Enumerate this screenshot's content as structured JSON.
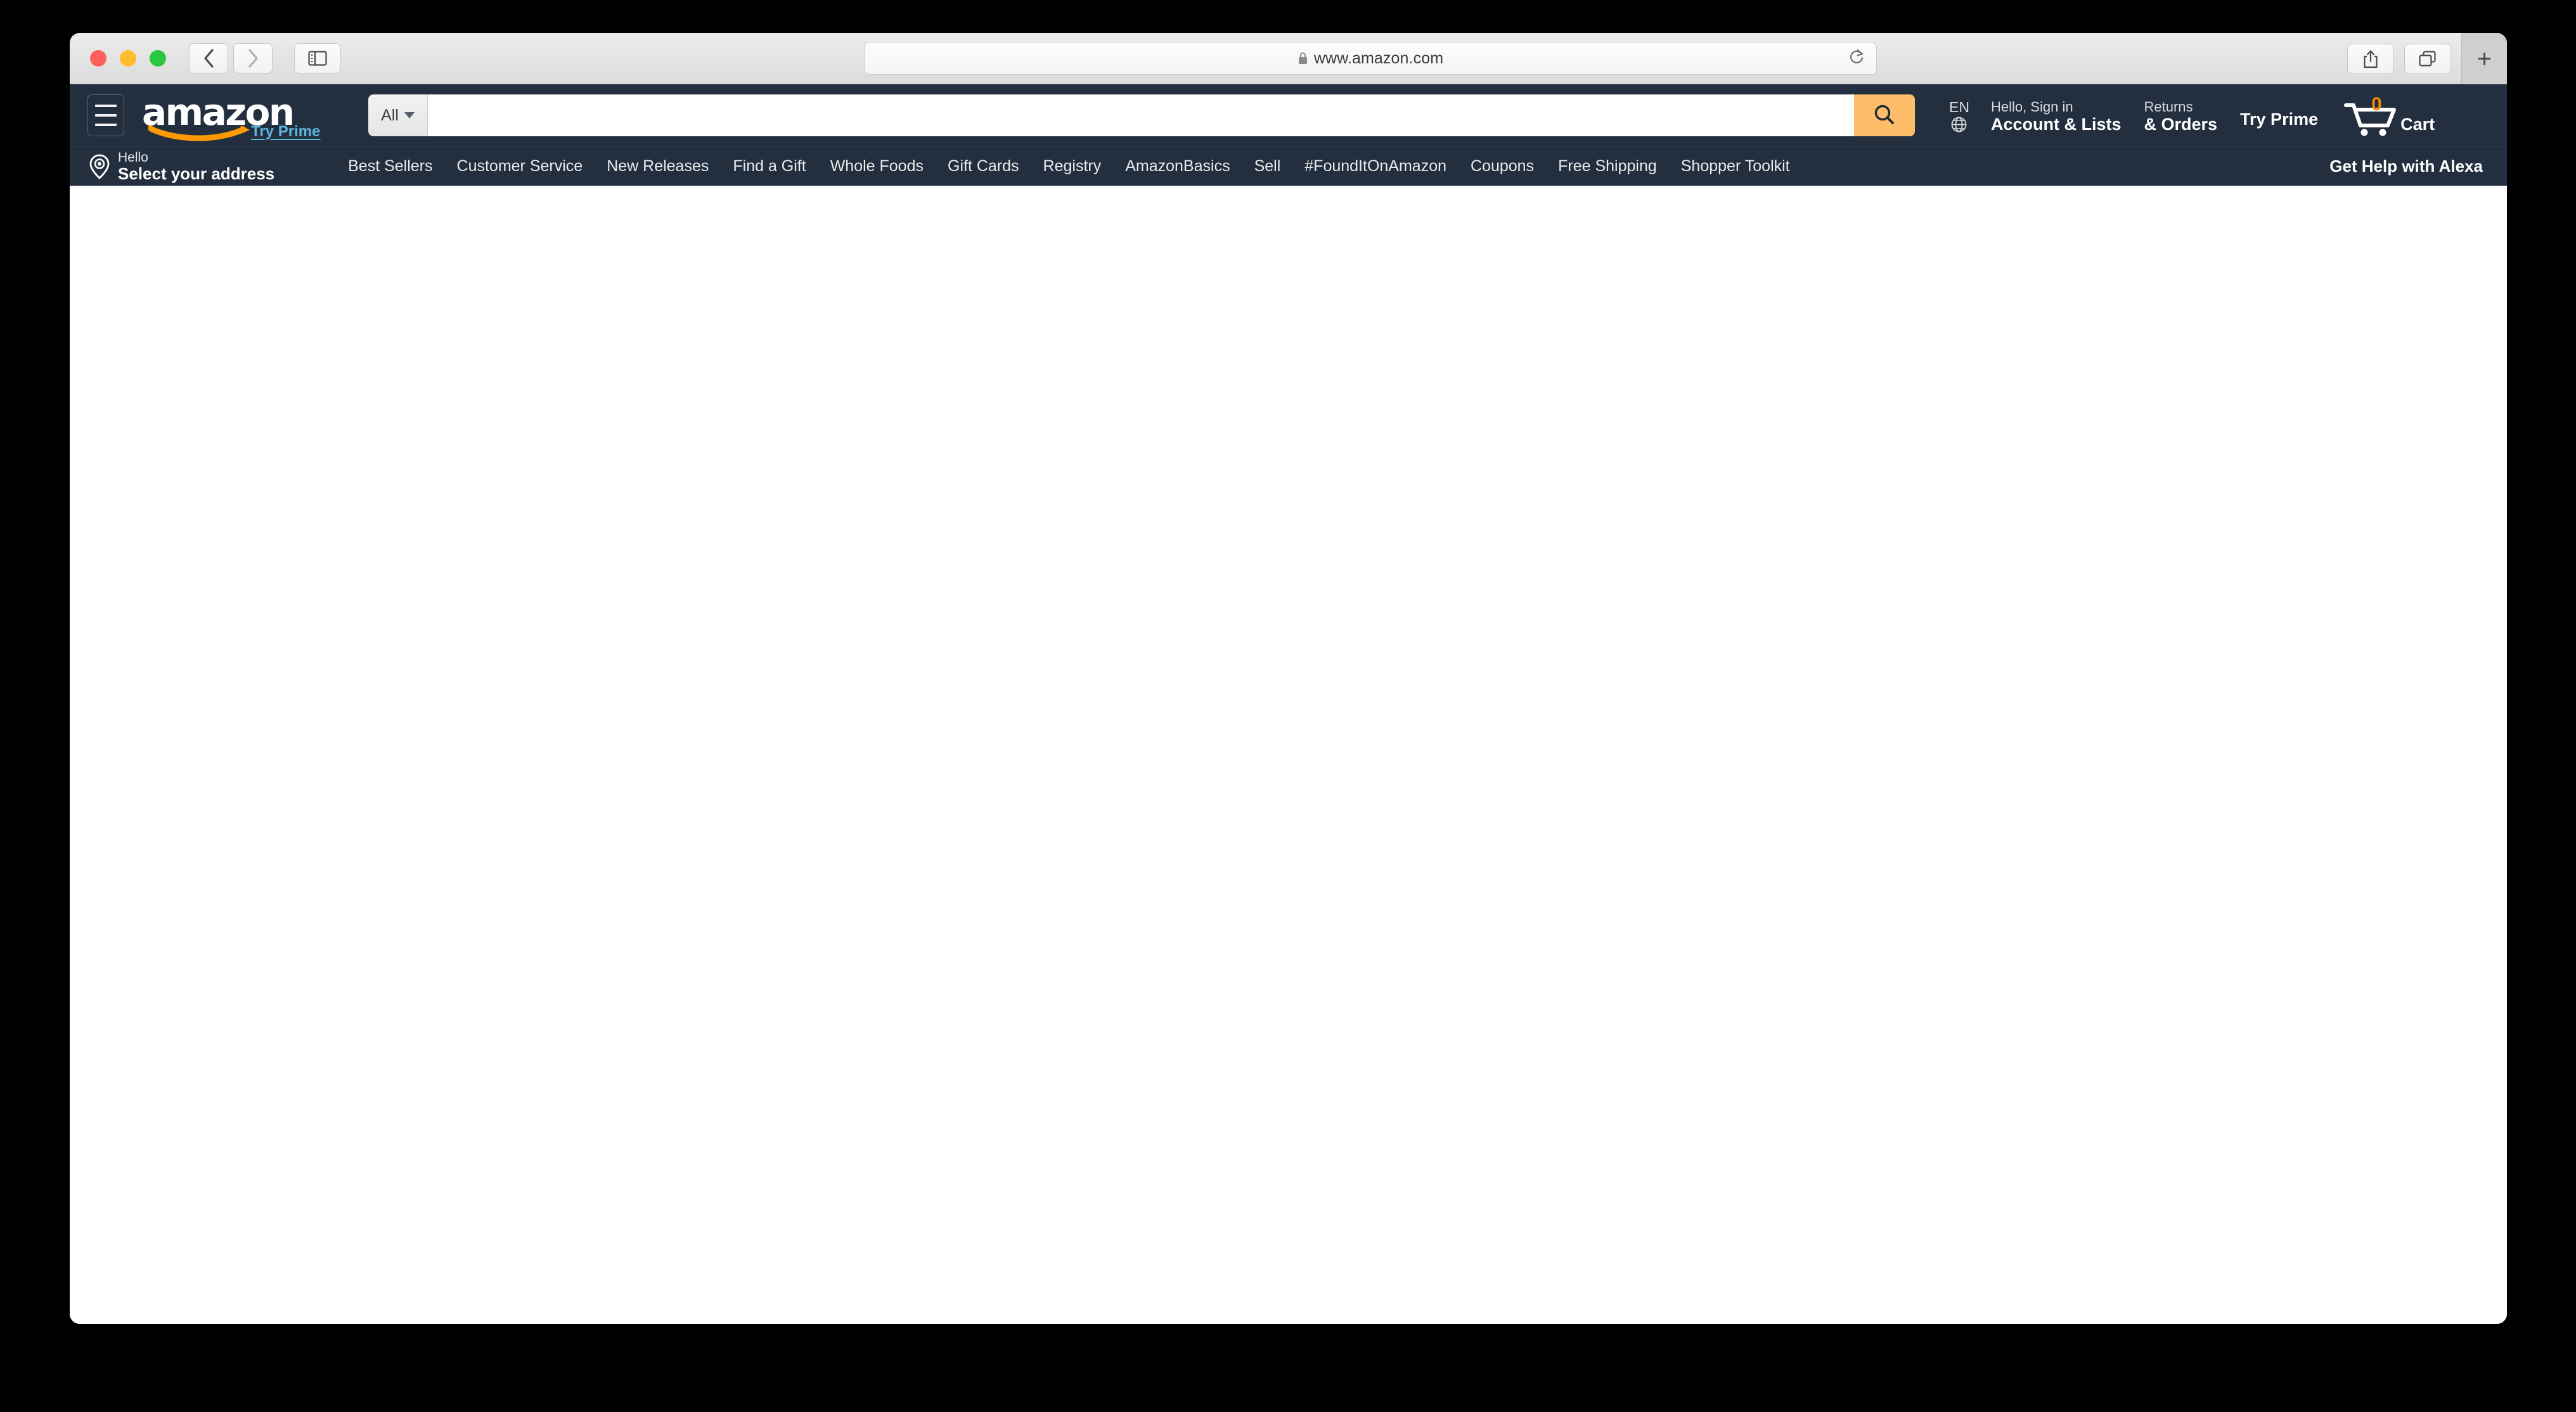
{
  "browser": {
    "url": "www.amazon.com",
    "lock_icon": "lock-icon",
    "reload_icon": "reload-icon",
    "back_icon": "chevron-left-icon",
    "forward_icon": "chevron-right-icon",
    "sidebar_icon": "sidebar-toggle-icon",
    "share_icon": "share-icon",
    "tab_overview_icon": "tab-overview-icon",
    "new_tab_label": "+"
  },
  "header": {
    "menu_icon": "hamburger-menu-icon",
    "logo_text": "amazon",
    "try_prime_link": "Try Prime",
    "search": {
      "category": "All",
      "value": "",
      "placeholder": "",
      "button_icon": "search-icon"
    },
    "language": {
      "code": "EN",
      "icon": "globe-icon"
    },
    "account": {
      "line1": "Hello, Sign in",
      "line2": "Account & Lists"
    },
    "orders": {
      "line1": "Returns",
      "line2": "& Orders"
    },
    "try_prime": "Try Prime",
    "cart": {
      "count": "0",
      "label": "Cart",
      "icon": "shopping-cart-icon"
    }
  },
  "subnav": {
    "location": {
      "icon": "location-pin-icon",
      "line1": "Hello",
      "line2": "Select your address"
    },
    "links": [
      {
        "label": "Best Sellers"
      },
      {
        "label": "Customer Service"
      },
      {
        "label": "New Releases"
      },
      {
        "label": "Find a Gift"
      },
      {
        "label": "Whole Foods"
      },
      {
        "label": "Gift Cards"
      },
      {
        "label": "Registry"
      },
      {
        "label": "AmazonBasics"
      },
      {
        "label": "Sell"
      },
      {
        "label": "#FoundItOnAmazon"
      },
      {
        "label": "Coupons"
      },
      {
        "label": "Free Shipping"
      },
      {
        "label": "Shopper Toolkit"
      }
    ],
    "alexa_link": "Get Help with Alexa"
  },
  "colors": {
    "nav_background": "#232f3e",
    "search_button": "#febd69",
    "cart_badge": "#f08804",
    "prime_link": "#5bb5e0",
    "page_background": "#ffffff"
  }
}
